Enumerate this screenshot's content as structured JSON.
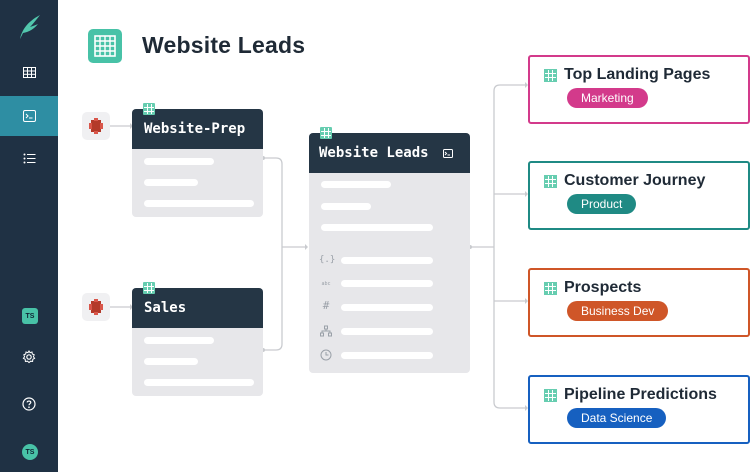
{
  "header": {
    "title": "Website Leads"
  },
  "sidebar": {
    "user_badge": "TS",
    "avatar_initials": "TS",
    "active_item": "sql-console"
  },
  "sources": [
    {
      "name": "Website-Prep"
    },
    {
      "name": "Sales"
    }
  ],
  "main_dataset": {
    "name": "Website Leads"
  },
  "destinations": [
    {
      "name": "Top Landing Pages",
      "tag": "Marketing",
      "color": "#d33a8b"
    },
    {
      "name": "Customer Journey",
      "tag": "Product",
      "color": "#1f8a84"
    },
    {
      "name": "Prospects",
      "tag": "Business Dev",
      "color": "#cf5628"
    },
    {
      "name": "Pipeline Predictions",
      "tag": "Data Science",
      "color": "#1660c0"
    }
  ],
  "colors": {
    "sidebar_bg": "#1f3144",
    "accent_teal": "#48c2a7",
    "card_header": "#253645"
  }
}
